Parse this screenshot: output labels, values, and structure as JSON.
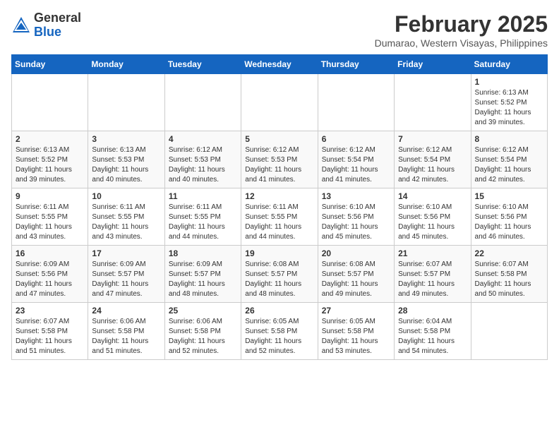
{
  "header": {
    "logo_general": "General",
    "logo_blue": "Blue",
    "month_year": "February 2025",
    "location": "Dumarao, Western Visayas, Philippines"
  },
  "weekdays": [
    "Sunday",
    "Monday",
    "Tuesday",
    "Wednesday",
    "Thursday",
    "Friday",
    "Saturday"
  ],
  "weeks": [
    [
      {
        "day": "",
        "sunrise": "",
        "sunset": "",
        "daylight": ""
      },
      {
        "day": "",
        "sunrise": "",
        "sunset": "",
        "daylight": ""
      },
      {
        "day": "",
        "sunrise": "",
        "sunset": "",
        "daylight": ""
      },
      {
        "day": "",
        "sunrise": "",
        "sunset": "",
        "daylight": ""
      },
      {
        "day": "",
        "sunrise": "",
        "sunset": "",
        "daylight": ""
      },
      {
        "day": "",
        "sunrise": "",
        "sunset": "",
        "daylight": ""
      },
      {
        "day": "1",
        "sunrise": "Sunrise: 6:13 AM",
        "sunset": "Sunset: 5:52 PM",
        "daylight": "Daylight: 11 hours and 39 minutes."
      }
    ],
    [
      {
        "day": "2",
        "sunrise": "Sunrise: 6:13 AM",
        "sunset": "Sunset: 5:52 PM",
        "daylight": "Daylight: 11 hours and 39 minutes."
      },
      {
        "day": "3",
        "sunrise": "Sunrise: 6:13 AM",
        "sunset": "Sunset: 5:53 PM",
        "daylight": "Daylight: 11 hours and 40 minutes."
      },
      {
        "day": "4",
        "sunrise": "Sunrise: 6:12 AM",
        "sunset": "Sunset: 5:53 PM",
        "daylight": "Daylight: 11 hours and 40 minutes."
      },
      {
        "day": "5",
        "sunrise": "Sunrise: 6:12 AM",
        "sunset": "Sunset: 5:53 PM",
        "daylight": "Daylight: 11 hours and 41 minutes."
      },
      {
        "day": "6",
        "sunrise": "Sunrise: 6:12 AM",
        "sunset": "Sunset: 5:54 PM",
        "daylight": "Daylight: 11 hours and 41 minutes."
      },
      {
        "day": "7",
        "sunrise": "Sunrise: 6:12 AM",
        "sunset": "Sunset: 5:54 PM",
        "daylight": "Daylight: 11 hours and 42 minutes."
      },
      {
        "day": "8",
        "sunrise": "Sunrise: 6:12 AM",
        "sunset": "Sunset: 5:54 PM",
        "daylight": "Daylight: 11 hours and 42 minutes."
      }
    ],
    [
      {
        "day": "9",
        "sunrise": "Sunrise: 6:11 AM",
        "sunset": "Sunset: 5:55 PM",
        "daylight": "Daylight: 11 hours and 43 minutes."
      },
      {
        "day": "10",
        "sunrise": "Sunrise: 6:11 AM",
        "sunset": "Sunset: 5:55 PM",
        "daylight": "Daylight: 11 hours and 43 minutes."
      },
      {
        "day": "11",
        "sunrise": "Sunrise: 6:11 AM",
        "sunset": "Sunset: 5:55 PM",
        "daylight": "Daylight: 11 hours and 44 minutes."
      },
      {
        "day": "12",
        "sunrise": "Sunrise: 6:11 AM",
        "sunset": "Sunset: 5:55 PM",
        "daylight": "Daylight: 11 hours and 44 minutes."
      },
      {
        "day": "13",
        "sunrise": "Sunrise: 6:10 AM",
        "sunset": "Sunset: 5:56 PM",
        "daylight": "Daylight: 11 hours and 45 minutes."
      },
      {
        "day": "14",
        "sunrise": "Sunrise: 6:10 AM",
        "sunset": "Sunset: 5:56 PM",
        "daylight": "Daylight: 11 hours and 45 minutes."
      },
      {
        "day": "15",
        "sunrise": "Sunrise: 6:10 AM",
        "sunset": "Sunset: 5:56 PM",
        "daylight": "Daylight: 11 hours and 46 minutes."
      }
    ],
    [
      {
        "day": "16",
        "sunrise": "Sunrise: 6:09 AM",
        "sunset": "Sunset: 5:56 PM",
        "daylight": "Daylight: 11 hours and 47 minutes."
      },
      {
        "day": "17",
        "sunrise": "Sunrise: 6:09 AM",
        "sunset": "Sunset: 5:57 PM",
        "daylight": "Daylight: 11 hours and 47 minutes."
      },
      {
        "day": "18",
        "sunrise": "Sunrise: 6:09 AM",
        "sunset": "Sunset: 5:57 PM",
        "daylight": "Daylight: 11 hours and 48 minutes."
      },
      {
        "day": "19",
        "sunrise": "Sunrise: 6:08 AM",
        "sunset": "Sunset: 5:57 PM",
        "daylight": "Daylight: 11 hours and 48 minutes."
      },
      {
        "day": "20",
        "sunrise": "Sunrise: 6:08 AM",
        "sunset": "Sunset: 5:57 PM",
        "daylight": "Daylight: 11 hours and 49 minutes."
      },
      {
        "day": "21",
        "sunrise": "Sunrise: 6:07 AM",
        "sunset": "Sunset: 5:57 PM",
        "daylight": "Daylight: 11 hours and 49 minutes."
      },
      {
        "day": "22",
        "sunrise": "Sunrise: 6:07 AM",
        "sunset": "Sunset: 5:58 PM",
        "daylight": "Daylight: 11 hours and 50 minutes."
      }
    ],
    [
      {
        "day": "23",
        "sunrise": "Sunrise: 6:07 AM",
        "sunset": "Sunset: 5:58 PM",
        "daylight": "Daylight: 11 hours and 51 minutes."
      },
      {
        "day": "24",
        "sunrise": "Sunrise: 6:06 AM",
        "sunset": "Sunset: 5:58 PM",
        "daylight": "Daylight: 11 hours and 51 minutes."
      },
      {
        "day": "25",
        "sunrise": "Sunrise: 6:06 AM",
        "sunset": "Sunset: 5:58 PM",
        "daylight": "Daylight: 11 hours and 52 minutes."
      },
      {
        "day": "26",
        "sunrise": "Sunrise: 6:05 AM",
        "sunset": "Sunset: 5:58 PM",
        "daylight": "Daylight: 11 hours and 52 minutes."
      },
      {
        "day": "27",
        "sunrise": "Sunrise: 6:05 AM",
        "sunset": "Sunset: 5:58 PM",
        "daylight": "Daylight: 11 hours and 53 minutes."
      },
      {
        "day": "28",
        "sunrise": "Sunrise: 6:04 AM",
        "sunset": "Sunset: 5:58 PM",
        "daylight": "Daylight: 11 hours and 54 minutes."
      },
      {
        "day": "",
        "sunrise": "",
        "sunset": "",
        "daylight": ""
      }
    ]
  ]
}
